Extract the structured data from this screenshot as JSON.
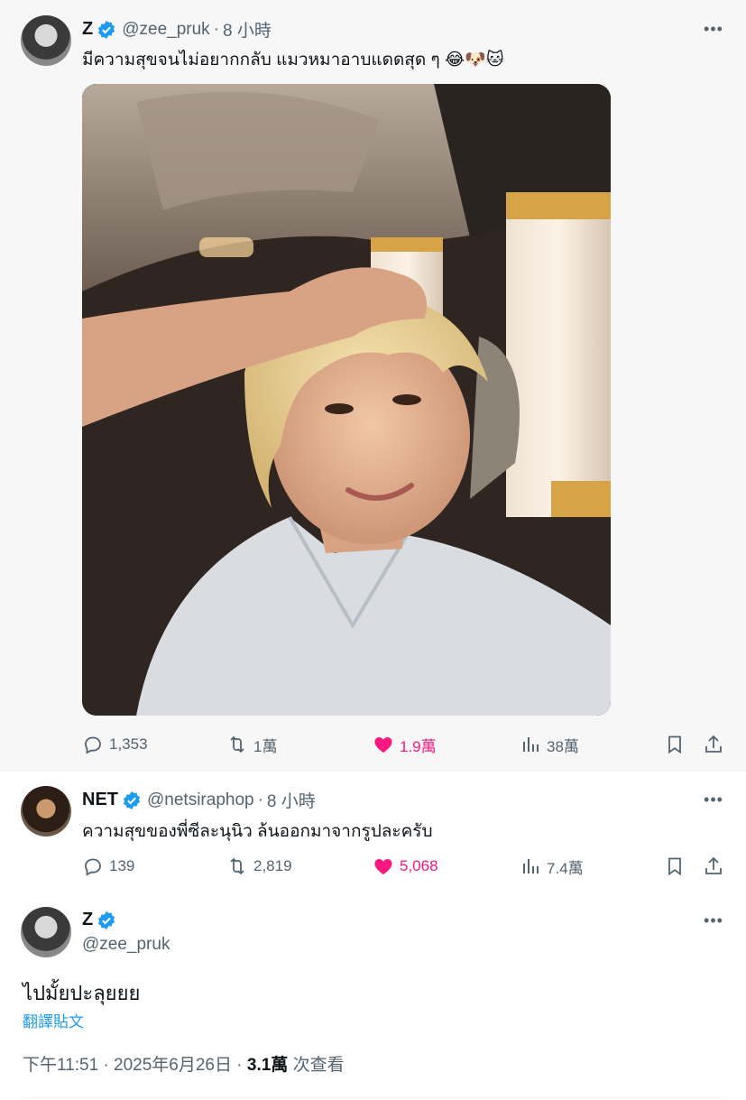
{
  "tweets": [
    {
      "name": "Z",
      "handle": "@zee_pruk",
      "separator": "·",
      "time": "8 小時",
      "text": "มีความสุขจนไม่อยากกลับ แมวหมาอาบแดดสุด ๆ 😂🐶🐱",
      "metrics": {
        "replies": "1,353",
        "reposts": "1萬",
        "likes": "1.9萬",
        "views": "38萬"
      }
    },
    {
      "name": "NET",
      "handle": "@netsiraphop",
      "separator": "·",
      "time": "8 小時",
      "text": "ความสุขของพี่ซีละนุนิว ล้นออกมาจากรูปละครับ",
      "metrics": {
        "replies": "139",
        "reposts": "2,819",
        "likes": "5,068",
        "views": "7.4萬"
      }
    }
  ],
  "main_tweet": {
    "name": "Z",
    "handle": "@zee_pruk",
    "text": "ไปมั้ยปะลุยยย",
    "translate_label": "翻譯貼文",
    "timestamp": "下午11:51 · 2025年6月26日 · ",
    "views_count": "3.1萬",
    "views_label": " 次查看"
  },
  "icons": {
    "verified": "verified-badge-icon",
    "more": "more-icon",
    "reply": "reply-icon",
    "repost": "repost-icon",
    "like": "heart-icon",
    "views": "views-icon",
    "bookmark": "bookmark-icon",
    "share": "share-icon"
  },
  "colors": {
    "verified": "#1d9bf0",
    "liked": "#f91880",
    "secondary_text": "#536471",
    "link": "#1d9bf0"
  }
}
